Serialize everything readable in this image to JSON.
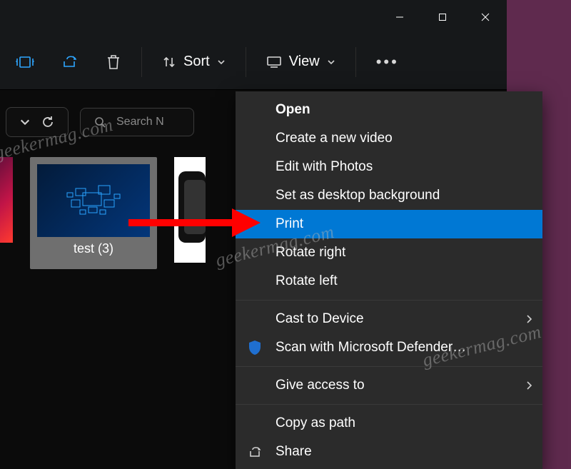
{
  "titlebar": {},
  "toolbar": {
    "sort_label": "Sort",
    "view_label": "View"
  },
  "filter": {
    "search_placeholder": "Search N"
  },
  "thumbs": {
    "item1_label": "test (3)"
  },
  "menu": {
    "open": "Open",
    "create_video": "Create a new video",
    "edit_photos": "Edit with Photos",
    "set_background": "Set as desktop background",
    "print": "Print",
    "rotate_right": "Rotate right",
    "rotate_left": "Rotate left",
    "cast": "Cast to Device",
    "scan": "Scan with Microsoft Defender…",
    "give_access": "Give access to",
    "copy_path": "Copy as path",
    "share": "Share"
  },
  "watermark": "geekermag.com"
}
